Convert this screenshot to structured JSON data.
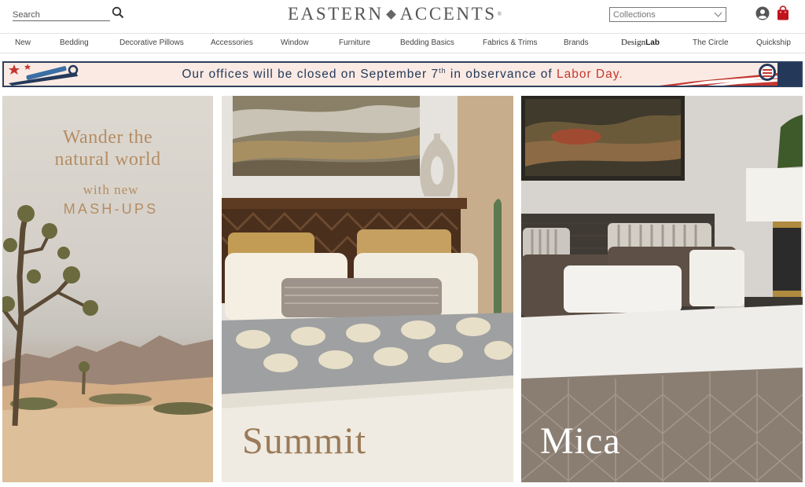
{
  "header": {
    "search_placeholder": "Search",
    "logo_left": "EASTERN",
    "logo_right": "ACCENTS",
    "logo_mark": "®",
    "collections_label": "Collections",
    "icons": {
      "search": "search-icon",
      "account": "account-icon",
      "bag": "shopping-bag-icon",
      "dropdown": "chevron-down-icon"
    }
  },
  "nav": {
    "items": [
      "New",
      "Bedding",
      "Decorative Pillows",
      "Accessories",
      "Window",
      "Furniture",
      "Bedding Basics",
      "Fabrics & Trims",
      "Brands"
    ],
    "designlab_a": "Design",
    "designlab_b": "Lab",
    "after": [
      "The Circle",
      "Quickship"
    ]
  },
  "banner": {
    "text_a": "Our offices will be closed on September 7",
    "text_sup": "th",
    "text_b": " in observance of ",
    "highlight": "Labor Day.",
    "colors": {
      "text": "#24395a",
      "highlight": "#c4372f",
      "background": "#faeae3",
      "border": "#2d3f5e"
    }
  },
  "panels": {
    "wander": {
      "line1": "Wander the",
      "line2": "natural world",
      "line3": "with new",
      "line4": "MASH-UPS"
    },
    "summit": {
      "title": "Summit"
    },
    "mica": {
      "title": "Mica"
    }
  },
  "colors": {
    "accent_bag": "#c0141c",
    "brand_gold": "#b58c63"
  }
}
